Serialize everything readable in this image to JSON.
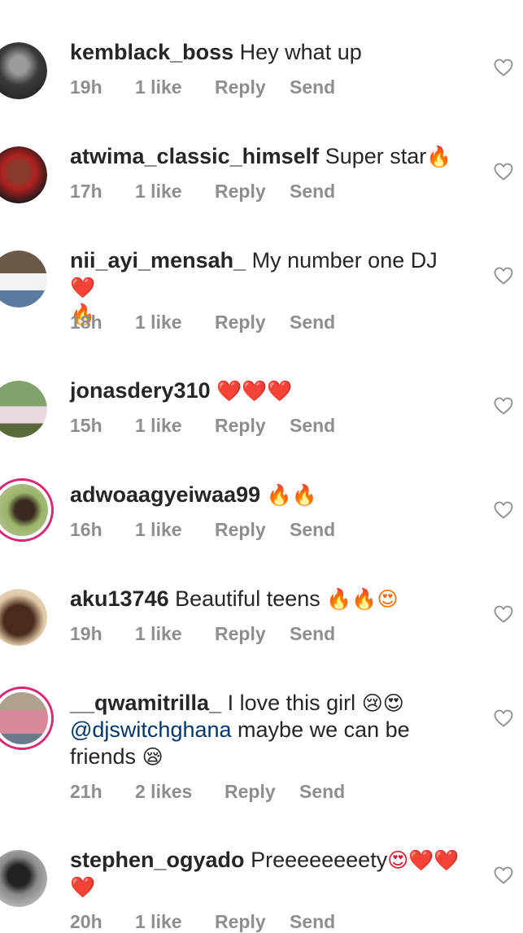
{
  "comments": [
    {
      "username": "kemblack_boss",
      "body": "Hey what up",
      "time": "19h",
      "likes": "1 like",
      "reply": "Reply",
      "send": "Send",
      "ring": false,
      "avatar_color": "#3a3a3a"
    },
    {
      "username": "atwima_classic_himself",
      "body": "Super star",
      "emoji": "🔥",
      "time": "17h",
      "likes": "1 like",
      "reply": "Reply",
      "send": "Send",
      "ring": false,
      "avatar_color": "#2a2a2a"
    },
    {
      "username": "nii_ayi_mensah_",
      "body": "My number one DJ",
      "emoji": "❤️",
      "emoji2": "🔥",
      "time": "18h",
      "likes": "1 like",
      "reply": "Reply",
      "send": "Send",
      "ring": false,
      "avatar_color": "#7b8a9a"
    },
    {
      "username": "jonasdery310",
      "emoji": "❤️❤️❤️",
      "time": "15h",
      "likes": "1 like",
      "reply": "Reply",
      "send": "Send",
      "ring": false,
      "avatar_color": "#6b8f5a"
    },
    {
      "username": "adwoaagyeiwaa99",
      "emoji": "🔥🔥",
      "time": "16h",
      "likes": "1 like",
      "reply": "Reply",
      "send": "Send",
      "ring": true,
      "avatar_color": "#8aa56a"
    },
    {
      "username": "aku13746",
      "body": "Beautiful teens",
      "emoji": "🔥🔥😍",
      "time": "19h",
      "likes": "1 like",
      "reply": "Reply",
      "send": "Send",
      "ring": false,
      "avatar_color": "#c4a47a"
    },
    {
      "username": "__qwamitrilla_",
      "body": "I love this girl",
      "emoji": "😢😍",
      "mention": "@djswitchghana",
      "body2": "maybe we can be friends",
      "emoji3": "😪",
      "time": "21h",
      "likes": "2 likes",
      "reply": "Reply",
      "send": "Send",
      "ring": true,
      "avatar_color": "#b5697a"
    },
    {
      "username": "stephen_ogyado",
      "body": "Preeeeeeeety",
      "emoji": "😍❤️❤️",
      "emoji2": "❤️",
      "time": "20h",
      "likes": "1 like",
      "reply": "Reply",
      "send": "Send",
      "ring": false,
      "avatar_color": "#555555"
    }
  ],
  "colors": {
    "text": "#262626",
    "meta": "#8e8e8e",
    "mention": "#00376b",
    "ring": "#d62976"
  },
  "icons": {
    "like": "heart-outline-icon"
  }
}
